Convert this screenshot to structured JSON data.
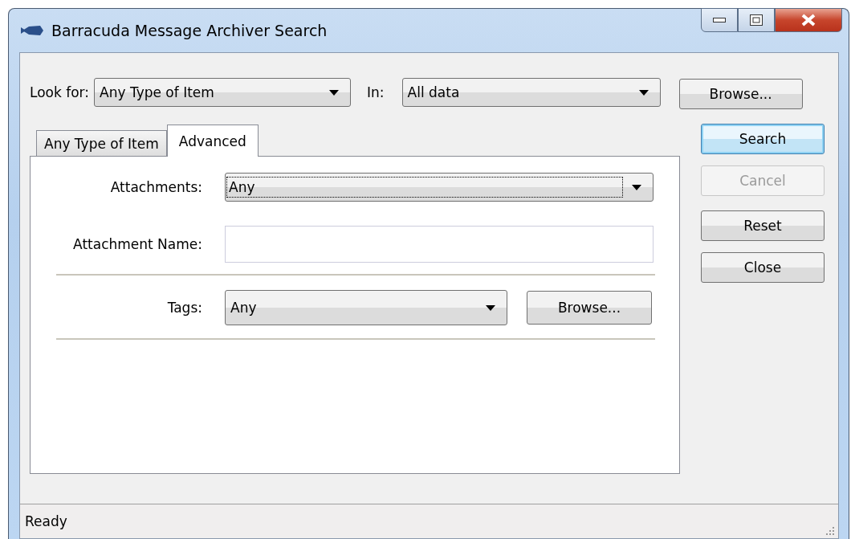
{
  "window": {
    "title": "Barracuda Message Archiver Search"
  },
  "look_for": {
    "label": "Look for:",
    "value": "Any Type of Item"
  },
  "in": {
    "label": "In:",
    "value": "All data"
  },
  "browse_button": {
    "label": "Browse..."
  },
  "tabs": [
    {
      "label": "Any Type of Item",
      "selected": false
    },
    {
      "label": "Advanced",
      "selected": true
    }
  ],
  "advanced": {
    "attachments": {
      "label": "Attachments:",
      "value": "Any",
      "focused": true
    },
    "attachment_name": {
      "label": "Attachment Name:"
    },
    "tags": {
      "label": "Tags:",
      "value": "Any"
    },
    "tags_browse_button": {
      "label": "Browse..."
    }
  },
  "buttons": [
    {
      "label": "Search",
      "default": true,
      "disabled": false
    },
    {
      "label": "Cancel",
      "default": false,
      "disabled": true
    },
    {
      "label": "Reset",
      "default": false,
      "disabled": false
    },
    {
      "label": "Close",
      "default": false,
      "disabled": false
    }
  ],
  "status_bar": {
    "text": "Ready"
  }
}
